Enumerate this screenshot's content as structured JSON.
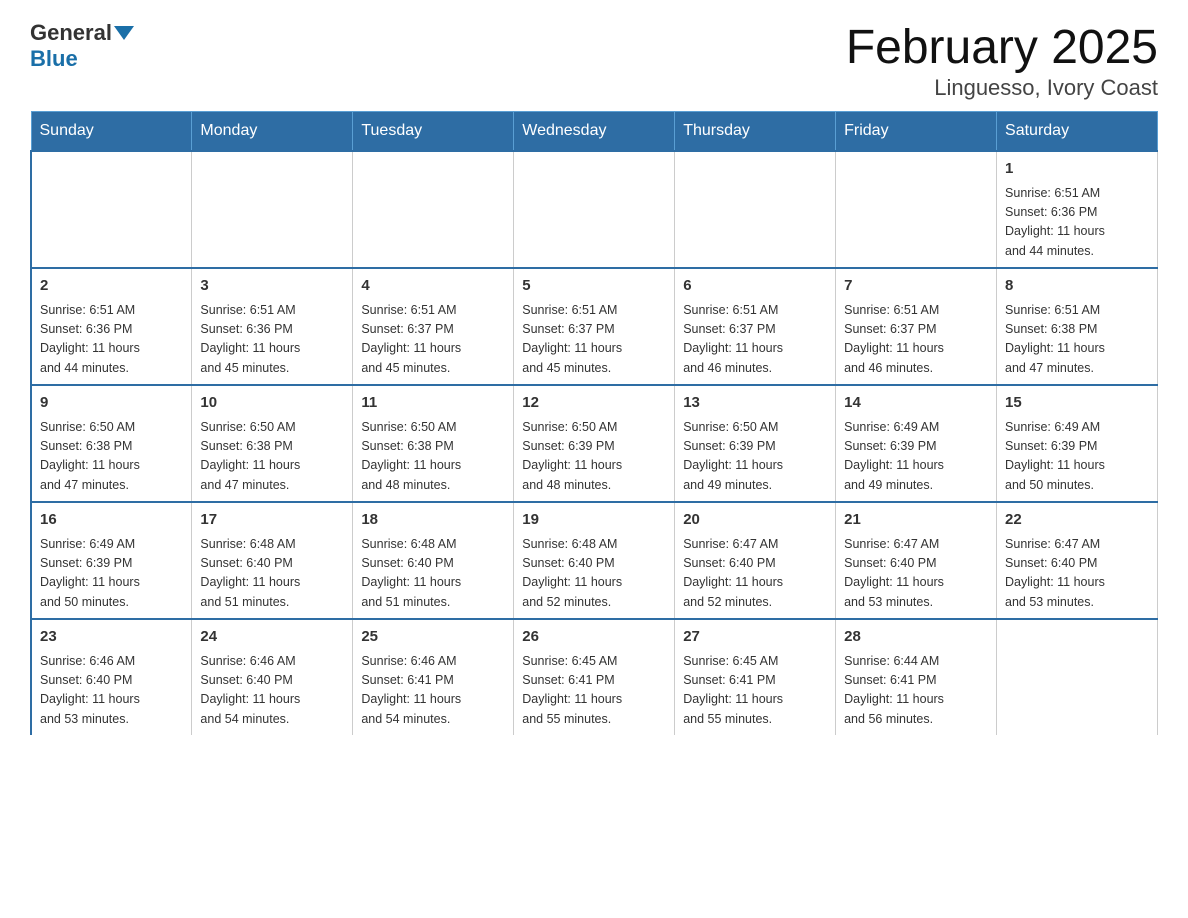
{
  "header": {
    "logo_general": "General",
    "logo_blue": "Blue",
    "month_title": "February 2025",
    "location": "Linguesso, Ivory Coast"
  },
  "weekdays": [
    "Sunday",
    "Monday",
    "Tuesday",
    "Wednesday",
    "Thursday",
    "Friday",
    "Saturday"
  ],
  "weeks": [
    [
      {
        "day": "",
        "info": ""
      },
      {
        "day": "",
        "info": ""
      },
      {
        "day": "",
        "info": ""
      },
      {
        "day": "",
        "info": ""
      },
      {
        "day": "",
        "info": ""
      },
      {
        "day": "",
        "info": ""
      },
      {
        "day": "1",
        "info": "Sunrise: 6:51 AM\nSunset: 6:36 PM\nDaylight: 11 hours\nand 44 minutes."
      }
    ],
    [
      {
        "day": "2",
        "info": "Sunrise: 6:51 AM\nSunset: 6:36 PM\nDaylight: 11 hours\nand 44 minutes."
      },
      {
        "day": "3",
        "info": "Sunrise: 6:51 AM\nSunset: 6:36 PM\nDaylight: 11 hours\nand 45 minutes."
      },
      {
        "day": "4",
        "info": "Sunrise: 6:51 AM\nSunset: 6:37 PM\nDaylight: 11 hours\nand 45 minutes."
      },
      {
        "day": "5",
        "info": "Sunrise: 6:51 AM\nSunset: 6:37 PM\nDaylight: 11 hours\nand 45 minutes."
      },
      {
        "day": "6",
        "info": "Sunrise: 6:51 AM\nSunset: 6:37 PM\nDaylight: 11 hours\nand 46 minutes."
      },
      {
        "day": "7",
        "info": "Sunrise: 6:51 AM\nSunset: 6:37 PM\nDaylight: 11 hours\nand 46 minutes."
      },
      {
        "day": "8",
        "info": "Sunrise: 6:51 AM\nSunset: 6:38 PM\nDaylight: 11 hours\nand 47 minutes."
      }
    ],
    [
      {
        "day": "9",
        "info": "Sunrise: 6:50 AM\nSunset: 6:38 PM\nDaylight: 11 hours\nand 47 minutes."
      },
      {
        "day": "10",
        "info": "Sunrise: 6:50 AM\nSunset: 6:38 PM\nDaylight: 11 hours\nand 47 minutes."
      },
      {
        "day": "11",
        "info": "Sunrise: 6:50 AM\nSunset: 6:38 PM\nDaylight: 11 hours\nand 48 minutes."
      },
      {
        "day": "12",
        "info": "Sunrise: 6:50 AM\nSunset: 6:39 PM\nDaylight: 11 hours\nand 48 minutes."
      },
      {
        "day": "13",
        "info": "Sunrise: 6:50 AM\nSunset: 6:39 PM\nDaylight: 11 hours\nand 49 minutes."
      },
      {
        "day": "14",
        "info": "Sunrise: 6:49 AM\nSunset: 6:39 PM\nDaylight: 11 hours\nand 49 minutes."
      },
      {
        "day": "15",
        "info": "Sunrise: 6:49 AM\nSunset: 6:39 PM\nDaylight: 11 hours\nand 50 minutes."
      }
    ],
    [
      {
        "day": "16",
        "info": "Sunrise: 6:49 AM\nSunset: 6:39 PM\nDaylight: 11 hours\nand 50 minutes."
      },
      {
        "day": "17",
        "info": "Sunrise: 6:48 AM\nSunset: 6:40 PM\nDaylight: 11 hours\nand 51 minutes."
      },
      {
        "day": "18",
        "info": "Sunrise: 6:48 AM\nSunset: 6:40 PM\nDaylight: 11 hours\nand 51 minutes."
      },
      {
        "day": "19",
        "info": "Sunrise: 6:48 AM\nSunset: 6:40 PM\nDaylight: 11 hours\nand 52 minutes."
      },
      {
        "day": "20",
        "info": "Sunrise: 6:47 AM\nSunset: 6:40 PM\nDaylight: 11 hours\nand 52 minutes."
      },
      {
        "day": "21",
        "info": "Sunrise: 6:47 AM\nSunset: 6:40 PM\nDaylight: 11 hours\nand 53 minutes."
      },
      {
        "day": "22",
        "info": "Sunrise: 6:47 AM\nSunset: 6:40 PM\nDaylight: 11 hours\nand 53 minutes."
      }
    ],
    [
      {
        "day": "23",
        "info": "Sunrise: 6:46 AM\nSunset: 6:40 PM\nDaylight: 11 hours\nand 53 minutes."
      },
      {
        "day": "24",
        "info": "Sunrise: 6:46 AM\nSunset: 6:40 PM\nDaylight: 11 hours\nand 54 minutes."
      },
      {
        "day": "25",
        "info": "Sunrise: 6:46 AM\nSunset: 6:41 PM\nDaylight: 11 hours\nand 54 minutes."
      },
      {
        "day": "26",
        "info": "Sunrise: 6:45 AM\nSunset: 6:41 PM\nDaylight: 11 hours\nand 55 minutes."
      },
      {
        "day": "27",
        "info": "Sunrise: 6:45 AM\nSunset: 6:41 PM\nDaylight: 11 hours\nand 55 minutes."
      },
      {
        "day": "28",
        "info": "Sunrise: 6:44 AM\nSunset: 6:41 PM\nDaylight: 11 hours\nand 56 minutes."
      },
      {
        "day": "",
        "info": ""
      }
    ]
  ]
}
